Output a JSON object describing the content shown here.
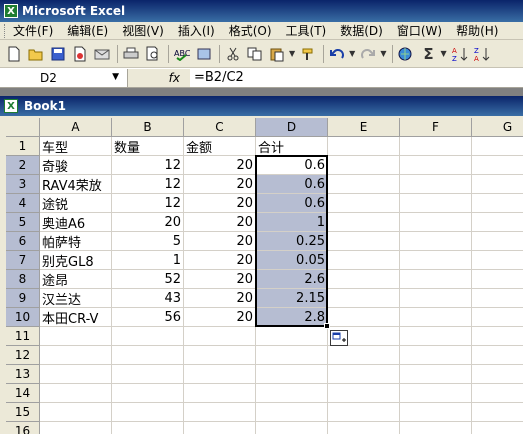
{
  "window": {
    "title": "Microsoft Excel",
    "app_icon": "X"
  },
  "menu": [
    "文件(F)",
    "编辑(E)",
    "视图(V)",
    "插入(I)",
    "格式(O)",
    "工具(T)",
    "数据(D)",
    "窗口(W)",
    "帮助(H)"
  ],
  "toolbar": {
    "icons": [
      "new-icon",
      "open-icon",
      "save-icon",
      "permission-icon",
      "email-icon",
      "print-icon",
      "print-preview-icon",
      "spelling-icon",
      "research-icon",
      "cut-icon",
      "copy-icon",
      "paste-icon",
      "format-painter-icon",
      "undo-icon",
      "redo-icon",
      "hyperlink-icon",
      "autosum-icon",
      "sort-asc-icon",
      "sort-desc-icon"
    ],
    "autosum_glyph": "Σ"
  },
  "formula_bar": {
    "name_box": "D2",
    "fx_label": "fx",
    "formula": "=B2/C2"
  },
  "workbook": {
    "title": "Book1",
    "icon": "X"
  },
  "grid": {
    "columns": [
      "A",
      "B",
      "C",
      "D",
      "E",
      "F",
      "G"
    ],
    "selected_column": "D",
    "rows": [
      {
        "num": "1",
        "A": "车型",
        "B": "数量",
        "C": "金额",
        "D": "合计"
      },
      {
        "num": "2",
        "A": "奇骏",
        "B": "12",
        "C": "20",
        "D": "0.6"
      },
      {
        "num": "3",
        "A": "RAV4荣放",
        "B": "12",
        "C": "20",
        "D": "0.6"
      },
      {
        "num": "4",
        "A": "途锐",
        "B": "12",
        "C": "20",
        "D": "0.6"
      },
      {
        "num": "5",
        "A": "奥迪A6",
        "B": "20",
        "C": "20",
        "D": "1"
      },
      {
        "num": "6",
        "A": "帕萨特",
        "B": "5",
        "C": "20",
        "D": "0.25"
      },
      {
        "num": "7",
        "A": "别克GL8",
        "B": "1",
        "C": "20",
        "D": "0.05"
      },
      {
        "num": "8",
        "A": "途昂",
        "B": "52",
        "C": "20",
        "D": "2.6"
      },
      {
        "num": "9",
        "A": "汉兰达",
        "B": "43",
        "C": "20",
        "D": "2.15"
      },
      {
        "num": "10",
        "A": "本田CR-V",
        "B": "56",
        "C": "20",
        "D": "2.8"
      },
      {
        "num": "11"
      },
      {
        "num": "12"
      },
      {
        "num": "13"
      },
      {
        "num": "14"
      },
      {
        "num": "15"
      },
      {
        "num": "16"
      }
    ]
  }
}
